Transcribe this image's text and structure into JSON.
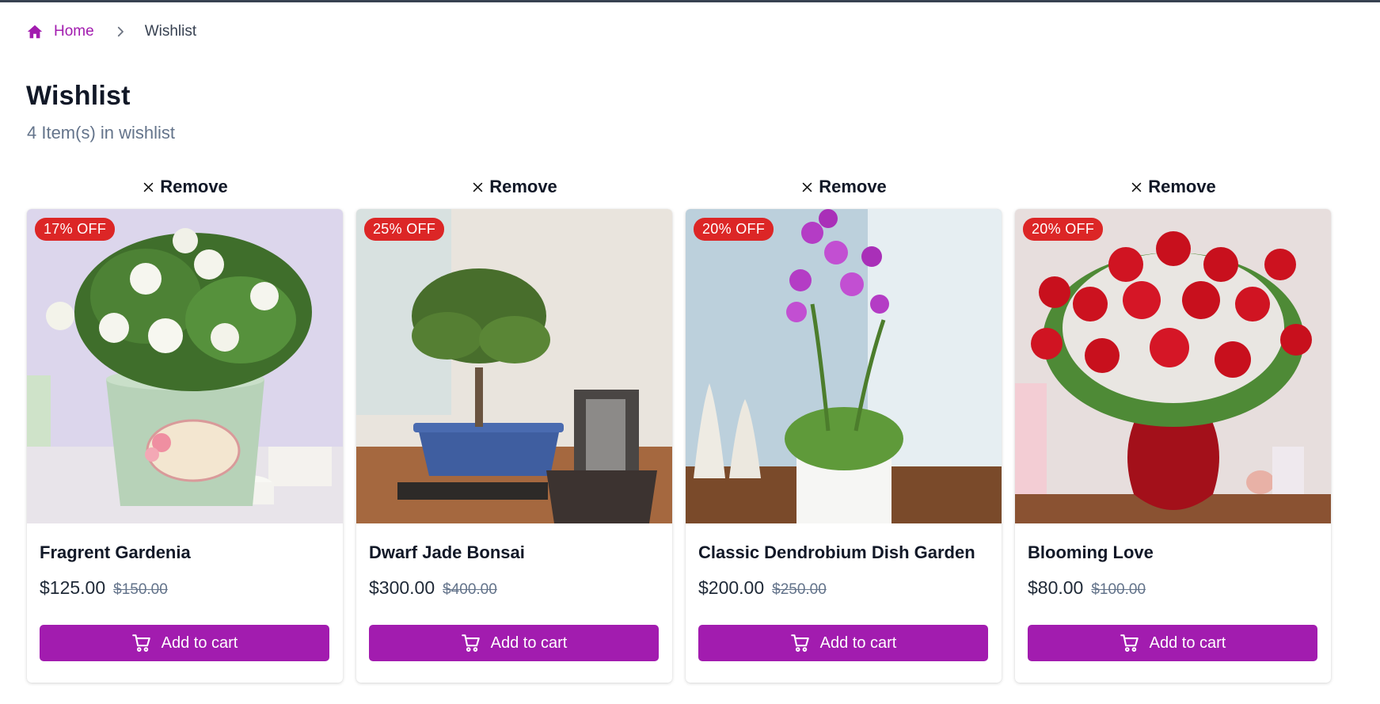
{
  "breadcrumb": {
    "home_label": "Home",
    "current_label": "Wishlist"
  },
  "page": {
    "title": "Wishlist",
    "subtitle": "4 Item(s) in wishlist"
  },
  "colors": {
    "accent": "#a21caf",
    "badge": "#dc2626"
  },
  "icons": {
    "home": "home-icon",
    "chevron": "chevron-right-icon",
    "remove": "close-icon",
    "cart": "cart-icon"
  },
  "items": [
    {
      "remove_label": "Remove",
      "badge": "17% OFF",
      "name": "Fragrent Gardenia",
      "price": "$125.00",
      "old_price": "$150.00",
      "cart_label": "Add to cart"
    },
    {
      "remove_label": "Remove",
      "badge": "25% OFF",
      "name": "Dwarf Jade Bonsai",
      "price": "$300.00",
      "old_price": "$400.00",
      "cart_label": "Add to cart"
    },
    {
      "remove_label": "Remove",
      "badge": "20% OFF",
      "name": "Classic Dendrobium Dish Garden",
      "price": "$200.00",
      "old_price": "$250.00",
      "cart_label": "Add to cart"
    },
    {
      "remove_label": "Remove",
      "badge": "20% OFF",
      "name": "Blooming Love",
      "price": "$80.00",
      "old_price": "$100.00",
      "cart_label": "Add to cart"
    }
  ]
}
